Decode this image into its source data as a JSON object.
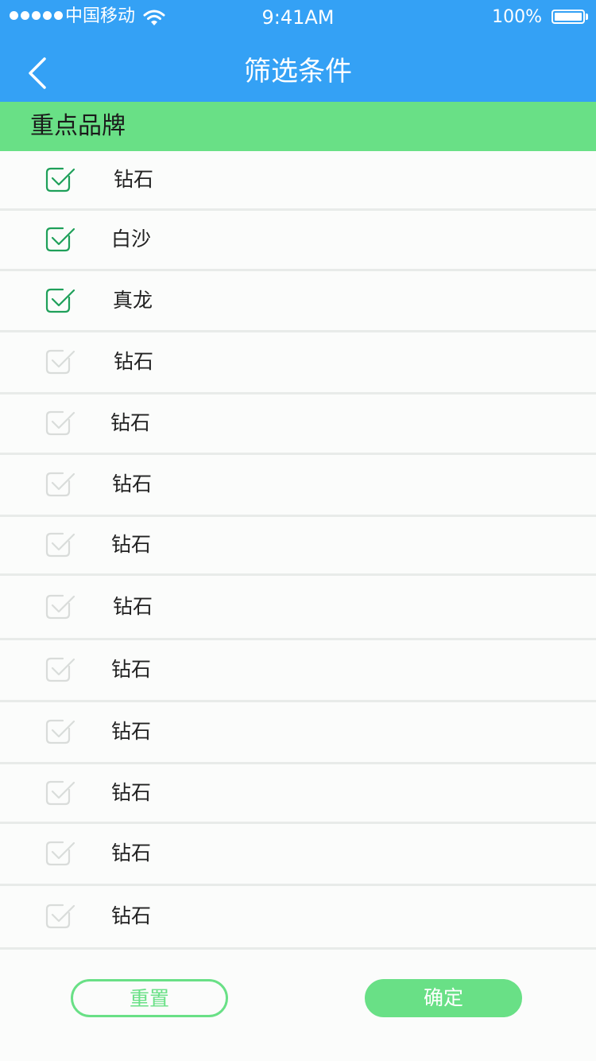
{
  "status_bar": {
    "carrier": "中国移动",
    "time": "9:41AM",
    "battery": "100%",
    "battery_level": 1.0
  },
  "nav": {
    "back_icon": "chevron-left-icon",
    "title": "筛选条件"
  },
  "section": {
    "title": "重点品牌"
  },
  "brands": [
    {
      "label": "钻石",
      "checked": true
    },
    {
      "label": "白沙",
      "checked": true
    },
    {
      "label": "真龙",
      "checked": true
    },
    {
      "label": "钻石",
      "checked": false
    },
    {
      "label": "钻石",
      "checked": false
    },
    {
      "label": "钻石",
      "checked": false
    },
    {
      "label": "钻石",
      "checked": false
    },
    {
      "label": "钻石",
      "checked": false
    },
    {
      "label": "钻石",
      "checked": false
    },
    {
      "label": "钻石",
      "checked": false
    },
    {
      "label": "钻石",
      "checked": false
    },
    {
      "label": "钻石",
      "checked": false
    },
    {
      "label": "钻石",
      "checked": false
    }
  ],
  "buttons": {
    "reset": "重置",
    "confirm": "确定"
  },
  "colors": {
    "nav_bg": "#34a1f5",
    "accent_green": "#69e086",
    "checked_green": "#1fa05a",
    "unchecked_gray": "#d9dcda"
  }
}
